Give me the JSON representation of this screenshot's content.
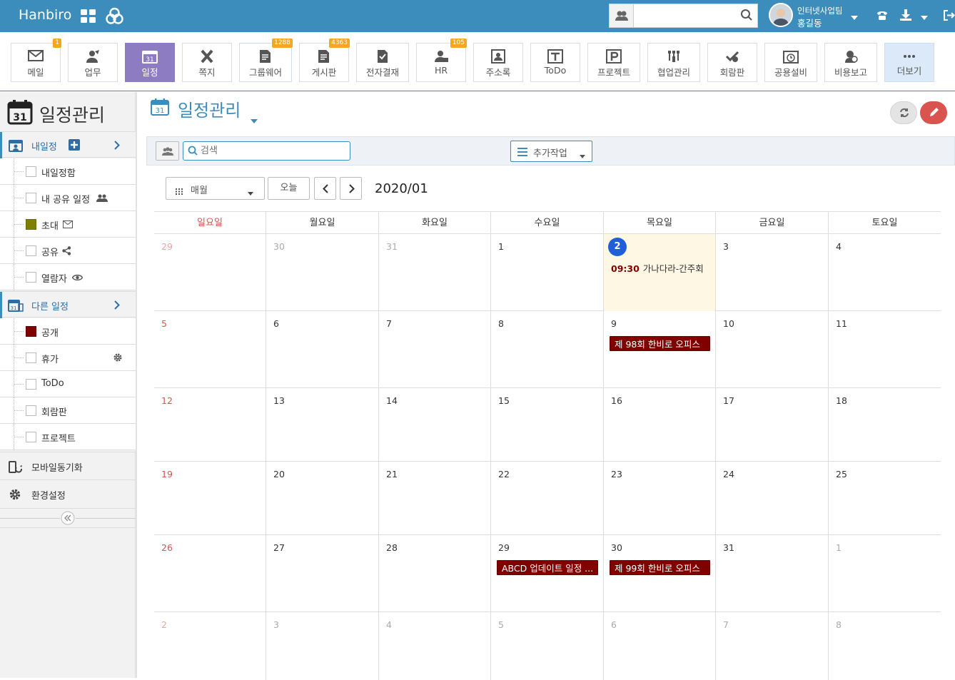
{
  "header": {
    "brand": "Hanbiro",
    "search_placeholder": "",
    "user": {
      "dept": "인터넷사업팀",
      "name": "홍길동"
    }
  },
  "apps": [
    {
      "label": "메일",
      "badge": "1",
      "icon": "mail-icon"
    },
    {
      "label": "업무",
      "badge": "",
      "icon": "task-icon"
    },
    {
      "label": "일정",
      "badge": "",
      "icon": "calendar-icon",
      "active": true
    },
    {
      "label": "쪽지",
      "badge": "",
      "icon": "note-icon"
    },
    {
      "label": "그룹웨어",
      "badge": "1288",
      "icon": "groupware-icon"
    },
    {
      "label": "게시판",
      "badge": "4363",
      "icon": "board-icon"
    },
    {
      "label": "전자결재",
      "badge": "",
      "icon": "approval-icon"
    },
    {
      "label": "HR",
      "badge": "105",
      "icon": "hr-icon"
    },
    {
      "label": "주소록",
      "badge": "",
      "icon": "contacts-icon"
    },
    {
      "label": "ToDo",
      "badge": "",
      "icon": "todo-icon"
    },
    {
      "label": "프로젝트",
      "badge": "",
      "icon": "project-icon"
    },
    {
      "label": "협업관리",
      "badge": "",
      "icon": "collab-icon"
    },
    {
      "label": "회람판",
      "badge": "",
      "icon": "circular-icon"
    },
    {
      "label": "공용설비",
      "badge": "",
      "icon": "facility-icon"
    },
    {
      "label": "비용보고",
      "badge": "",
      "icon": "expense-icon"
    },
    {
      "label": "더보기",
      "badge": "",
      "icon": "more-icon"
    }
  ],
  "sidebar": {
    "title": "일정관리",
    "my_calendar": "내일정",
    "my_items": [
      {
        "label": "내일정함",
        "color": ""
      },
      {
        "label": "내 공유 일정",
        "color": ""
      },
      {
        "label": "초대",
        "color": "#808000"
      },
      {
        "label": "공유",
        "color": ""
      },
      {
        "label": "열람자",
        "color": ""
      }
    ],
    "other_calendar": "다른 일정",
    "other_items": [
      {
        "label": "공개",
        "color": "#800000"
      },
      {
        "label": "휴가",
        "color": ""
      },
      {
        "label": "ToDo",
        "color": ""
      },
      {
        "label": "회람판",
        "color": ""
      },
      {
        "label": "프로젝트",
        "color": ""
      }
    ],
    "mobile_sync": "모바일동기화",
    "settings": "환경설정"
  },
  "main": {
    "title": "일정관리",
    "search_placeholder": "검색",
    "extra_action": "추가작업",
    "view_select": "매월",
    "today_btn": "오늘",
    "period": "2020/01",
    "weekdays": [
      "일요일",
      "월요일",
      "화요일",
      "수요일",
      "목요일",
      "금요일",
      "토요일"
    ]
  },
  "weeks": [
    {
      "days": [
        "29",
        "30",
        "31",
        "1",
        "2",
        "3",
        "4"
      ],
      "other": [
        true,
        true,
        true,
        false,
        false,
        false,
        false
      ]
    },
    {
      "days": [
        "5",
        "6",
        "7",
        "8",
        "9",
        "10",
        "11"
      ],
      "other": [
        false,
        false,
        false,
        false,
        false,
        false,
        false
      ]
    },
    {
      "days": [
        "12",
        "13",
        "14",
        "15",
        "16",
        "17",
        "18"
      ],
      "other": [
        false,
        false,
        false,
        false,
        false,
        false,
        false
      ]
    },
    {
      "days": [
        "19",
        "20",
        "21",
        "22",
        "23",
        "24",
        "25"
      ],
      "other": [
        false,
        false,
        false,
        false,
        false,
        false,
        false
      ]
    },
    {
      "days": [
        "26",
        "27",
        "28",
        "29",
        "30",
        "31",
        "1"
      ],
      "other": [
        false,
        false,
        false,
        false,
        false,
        false,
        true
      ]
    },
    {
      "days": [
        "2",
        "3",
        "4",
        "5",
        "6",
        "7",
        "8"
      ],
      "other": [
        true,
        true,
        true,
        true,
        true,
        true,
        true
      ]
    }
  ],
  "events": {
    "today_time": "09:30",
    "today_title": "가나다라-간주회",
    "jan9": "제 98회 한비로 오피스",
    "jan29": "ABCD 업데이트 일정 ...",
    "jan30": "제 99회 한비로 오피스"
  },
  "colors": {
    "primary": "#3c8dbc",
    "active_app": "#8e7cc3",
    "event": "#800000",
    "today_bg": "#fdf7e3",
    "today_circle": "#1f5ed8",
    "badge": "#f5a623",
    "edit_btn": "#d9534f"
  }
}
